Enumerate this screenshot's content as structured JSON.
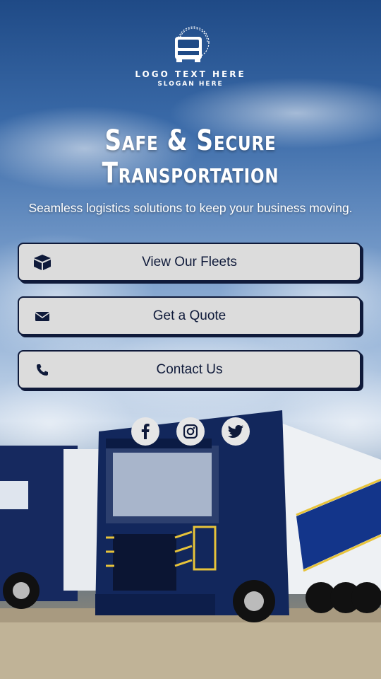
{
  "logo": {
    "text": "LOGO TEXT HERE",
    "slogan": "SLOGAN HERE"
  },
  "headline": {
    "line1": "Safe & Secure",
    "line2": "Transportation"
  },
  "subtitle": "Seamless logistics solutions to keep your business moving.",
  "buttons": [
    {
      "label": "View Our Fleets",
      "icon": "box-icon"
    },
    {
      "label": "Get a Quote",
      "icon": "envelope-icon"
    },
    {
      "label": "Contact Us",
      "icon": "phone-icon"
    }
  ],
  "social": [
    "facebook-icon",
    "instagram-icon",
    "twitter-icon"
  ],
  "colors": {
    "navy": "#0f1a3a",
    "button_bg": "#dcdcdc",
    "truck_blue": "#12275c",
    "accent_yellow": "#e7c33a"
  }
}
